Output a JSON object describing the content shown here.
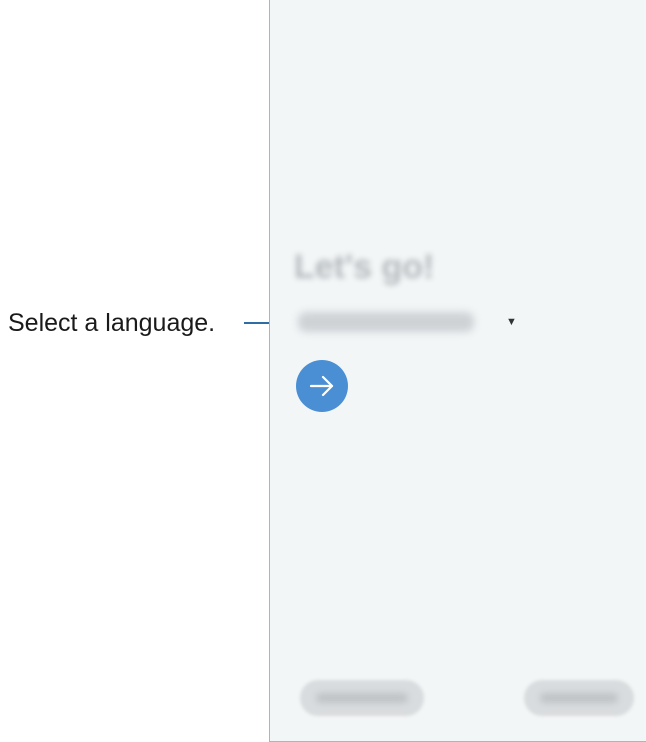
{
  "annotation": {
    "callout_text": "Select a language."
  },
  "screen": {
    "greeting": "Let's go!",
    "language": {
      "selected": "",
      "dropdown_icon": "caret-down-icon"
    },
    "next_button": {
      "icon": "arrow-right-icon",
      "color": "#4a8fd4"
    },
    "bottom_left_button": {
      "label": ""
    },
    "bottom_right_button": {
      "label": ""
    }
  },
  "colors": {
    "screen_background": "#f3f6f7",
    "leader_line": "#2e6da4",
    "accent": "#4a8fd4"
  }
}
